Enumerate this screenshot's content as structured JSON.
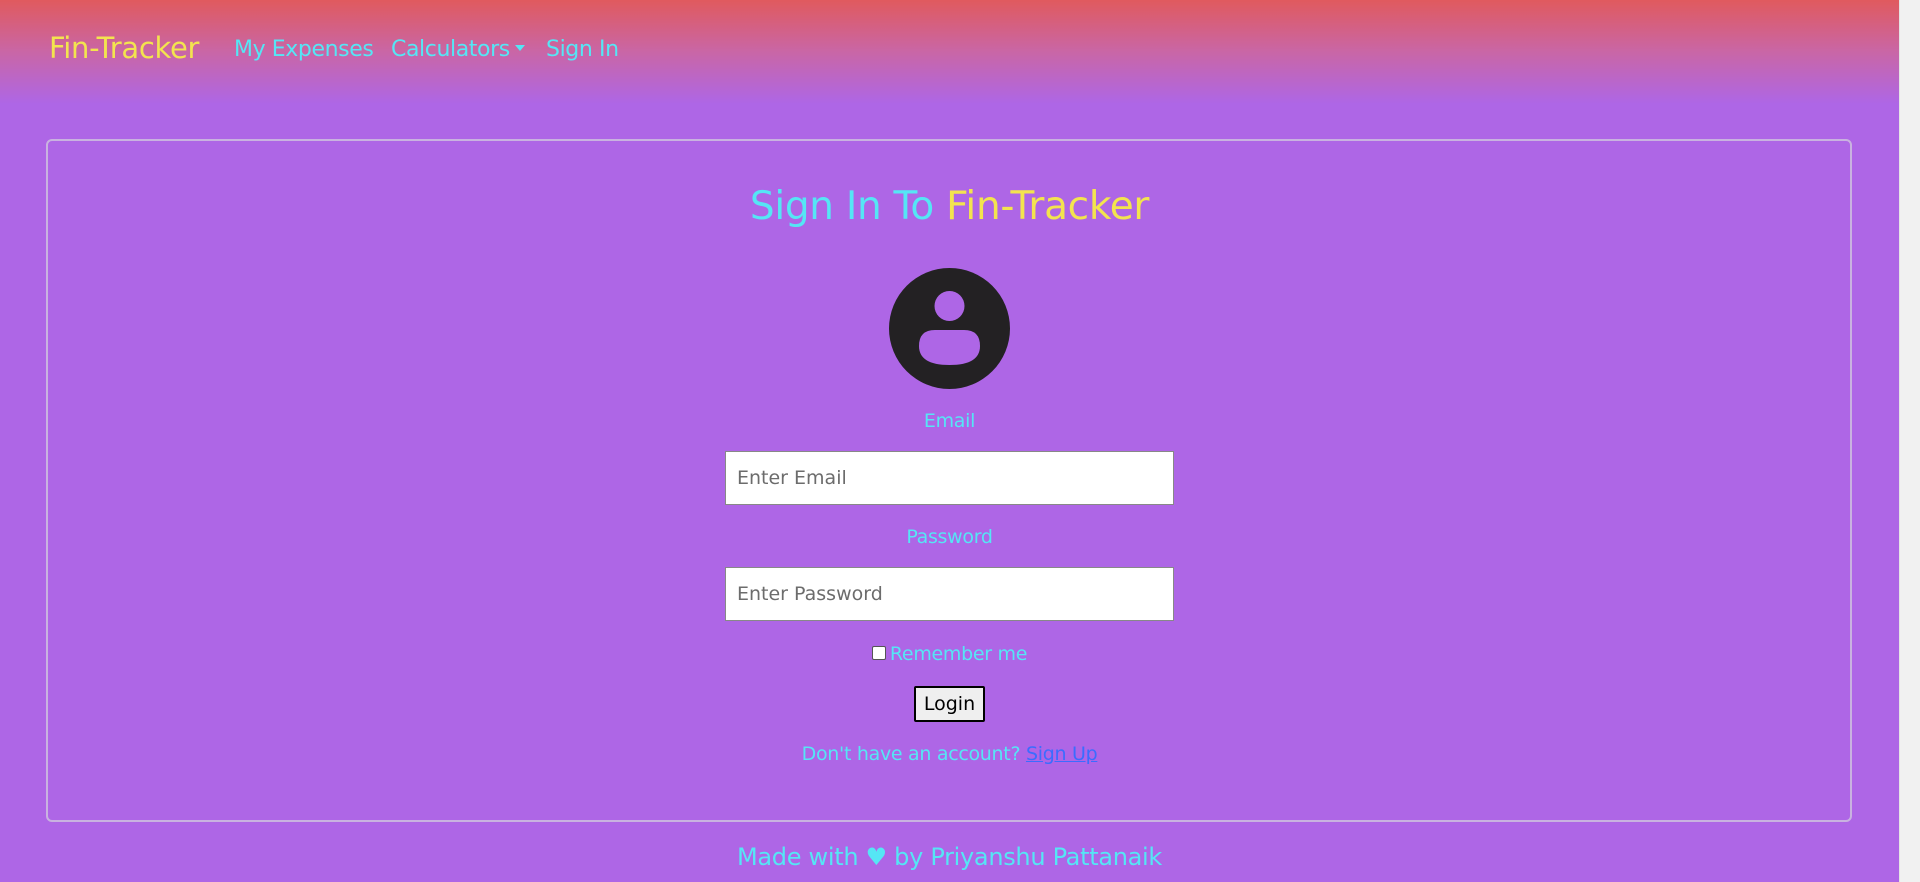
{
  "navbar": {
    "brand": "Fin-Tracker",
    "links": {
      "expenses": "My Expenses",
      "calculators": "Calculators",
      "signin": "Sign In"
    }
  },
  "form": {
    "title_part1": "Sign In To",
    "title_part2": "Fin-Tracker",
    "avatar_icon": "user-circle-icon",
    "email_label": "Email",
    "email_placeholder": "Enter Email",
    "email_value": "",
    "password_label": "Password",
    "password_placeholder": "Enter Password",
    "password_value": "",
    "remember_label": "Remember me",
    "remember_checked": false,
    "login_label": "Login",
    "signup_prompt": "Don't have an account?",
    "signup_link": "Sign Up"
  },
  "footer": {
    "text_before": "Made with",
    "heart": "♥",
    "text_after": "by Priyanshu Pattanaik"
  },
  "colors": {
    "background": "#ae66e6",
    "navbar_top": "#e05a5e",
    "accent_cyan": "#55e6f5",
    "accent_yellow": "#f3e44e",
    "link_blue": "#3b6cff"
  }
}
